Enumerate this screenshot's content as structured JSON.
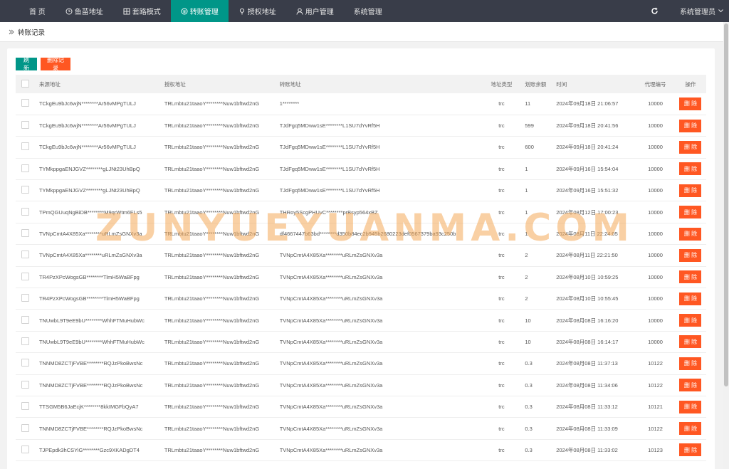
{
  "nav": {
    "items": [
      {
        "label": "首 页",
        "icon": ""
      },
      {
        "label": "鱼苗地址",
        "icon": "clock-icon"
      },
      {
        "label": "套路模式",
        "icon": "grid-icon"
      },
      {
        "label": "转账管理",
        "icon": "transfer-icon",
        "active": true
      },
      {
        "label": "授权地址",
        "icon": "pin-icon"
      },
      {
        "label": "用户管理",
        "icon": "user-icon"
      },
      {
        "label": "系统管理",
        "icon": ""
      }
    ],
    "admin_label": "系统管理员"
  },
  "breadcrumb": {
    "current": "转账记录"
  },
  "toolbar": {
    "refresh_label": "刷 新",
    "delete_records_label": "删除记录"
  },
  "table": {
    "headers": {
      "source": "来源地址",
      "auth": "授权地址",
      "to": "转账地址",
      "type": "地址类型",
      "balance": "划账余额",
      "time": "时间",
      "agent": "代理编号",
      "op": "操作"
    },
    "delete_label": "删 除",
    "rows": [
      {
        "source": "TCkgEu9bJc6wjN********Ar56vMPgTULJ",
        "auth": "TRLmbtu21taaoY********Nuw1bftwd2nG",
        "to": "1********",
        "type": "trc",
        "balance": "11",
        "time": "2024年09月18日 21:06:57",
        "agent": "10000"
      },
      {
        "source": "TCkgEu9bJc6wjN********Ar56vMPgTULJ",
        "auth": "TRLmbtu21taaoY********Nuw1bftwd2nG",
        "to": "TJdFgq5MDww1sE********L1SU7dYvRf5H",
        "type": "trc",
        "balance": "599",
        "time": "2024年09月18日 20:41:56",
        "agent": "10000"
      },
      {
        "source": "TCkgEu9bJc6wjN********Ar56vMPgTULJ",
        "auth": "TRLmbtu21taaoY********Nuw1bftwd2nG",
        "to": "TJdFgq5MDww1sE********L1SU7dYvRf5H",
        "type": "trc",
        "balance": "600",
        "time": "2024年09月18日 20:41:24",
        "agent": "10000"
      },
      {
        "source": "TYMkppgaENJGVZ********gLJNt23UhBpQ",
        "auth": "TRLmbtu21taaoY********Nuw1bftwd2nG",
        "to": "TJdFgq5MDww1sE********L1SU7dYvRf5H",
        "type": "trc",
        "balance": "1",
        "time": "2024年09月16日 15:54:04",
        "agent": "10000"
      },
      {
        "source": "TYMkppgaENJGVZ********gLJNt23UhBpQ",
        "auth": "TRLmbtu21taaoY********Nuw1bftwd2nG",
        "to": "TJdFgq5MDww1sE********L1SU7dYvRf5H",
        "type": "trc",
        "balance": "1",
        "time": "2024年09月16日 15:51:32",
        "agent": "10000"
      },
      {
        "source": "TPmQGUuqNgBiDB********M9qrWtm6FLs5",
        "auth": "TRLmbtu21taaoY********Nuw1bftwd2nG",
        "to": "THRoy5ScgPHUvC********prBsyp564xBZ",
        "type": "trc",
        "balance": "1",
        "time": "2024年08月12日 17:00:23",
        "agent": "10000"
      },
      {
        "source": "TVNpCmtA4X85Xa********uRLmZsGNXv3a",
        "auth": "TRLmbtu21taaoY********Nuw1bftwd2nG",
        "to": "df4667447b63bd********d350b84ec2b945b2680223def0567379ba93c250b",
        "type": "trc",
        "balance": "1",
        "time": "2024年08月11日 22:24:05",
        "agent": "10000"
      },
      {
        "source": "TVNpCmtA4X85Xa********uRLmZsGNXv3a",
        "auth": "TRLmbtu21taaoY********Nuw1bftwd2nG",
        "to": "TVNpCmtA4X85Xa********uRLmZsGNXv3a",
        "type": "trc",
        "balance": "2",
        "time": "2024年08月11日 22:21:50",
        "agent": "10000"
      },
      {
        "source": "TR4PzXPcWogsGB********TlmH5WaBFpg",
        "auth": "TRLmbtu21taaoY********Nuw1bftwd2nG",
        "to": "TVNpCmtA4X85Xa********uRLmZsGNXv3a",
        "type": "trc",
        "balance": "2",
        "time": "2024年08月10日 10:59:25",
        "agent": "10000"
      },
      {
        "source": "TR4PzXPcWogsGB********TlmH5WaBFpg",
        "auth": "TRLmbtu21taaoY********Nuw1bftwd2nG",
        "to": "TVNpCmtA4X85Xa********uRLmZsGNXv3a",
        "type": "trc",
        "balance": "2",
        "time": "2024年08月10日 10:55:45",
        "agent": "10000"
      },
      {
        "source": "TNUwbL9T9eE9bU********WhhFTMuHubWc",
        "auth": "TRLmbtu21taaoY********Nuw1bftwd2nG",
        "to": "TVNpCmtA4X85Xa********uRLmZsGNXv3a",
        "type": "trc",
        "balance": "10",
        "time": "2024年08月08日 16:16:20",
        "agent": "10000"
      },
      {
        "source": "TNUwbL9T9eE9bU********WhhFTMuHubWc",
        "auth": "TRLmbtu21taaoY********Nuw1bftwd2nG",
        "to": "TVNpCmtA4X85Xa********uRLmZsGNXv3a",
        "type": "trc",
        "balance": "10",
        "time": "2024年08月08日 16:14:17",
        "agent": "10000"
      },
      {
        "source": "TNNMD8ZCTjFVBE********RQJzPkoBwsNc",
        "auth": "TRLmbtu21taaoY********Nuw1bftwd2nG",
        "to": "TVNpCmtA4X85Xa********uRLmZsGNXv3a",
        "type": "trc",
        "balance": "0.3",
        "time": "2024年08月08日 11:37:13",
        "agent": "10122"
      },
      {
        "source": "TNNMD8ZCTjFVBE********RQJzPkoBwsNc",
        "auth": "TRLmbtu21taaoY********Nuw1bftwd2nG",
        "to": "TVNpCmtA4X85Xa********uRLmZsGNXv3a",
        "type": "trc",
        "balance": "0.3",
        "time": "2024年08月08日 11:34:06",
        "agent": "10122"
      },
      {
        "source": "TTSGM5B6JaEcjK********8kkIMGFbQyA7",
        "auth": "TRLmbtu21taaoY********Nuw1bftwd2nG",
        "to": "TVNpCmtA4X85Xa********uRLmZsGNXv3a",
        "type": "trc",
        "balance": "0.3",
        "time": "2024年08月08日 11:33:12",
        "agent": "10121"
      },
      {
        "source": "TNNMD8ZCTjFVBE********RQJzPkoBwsNc",
        "auth": "TRLmbtu21taaoY********Nuw1bftwd2nG",
        "to": "TVNpCmtA4X85Xa********uRLmZsGNXv3a",
        "type": "trc",
        "balance": "0.3",
        "time": "2024年08月08日 11:33:09",
        "agent": "10122"
      },
      {
        "source": "TJPEpdk3hCSYiG********Gzc9XKADgDT4",
        "auth": "TRLmbtu21taaoY********Nuw1bftwd2nG",
        "to": "TVNpCmtA4X85Xa********uRLmZsGNXv3a",
        "type": "trc",
        "balance": "0.3",
        "time": "2024年08月08日 11:33:02",
        "agent": "10123"
      }
    ]
  },
  "watermark": "ZUNYUEYUANMA.COM",
  "colors": {
    "nav_bg": "#393d49",
    "active": "#009688",
    "danger": "#ff5722"
  }
}
